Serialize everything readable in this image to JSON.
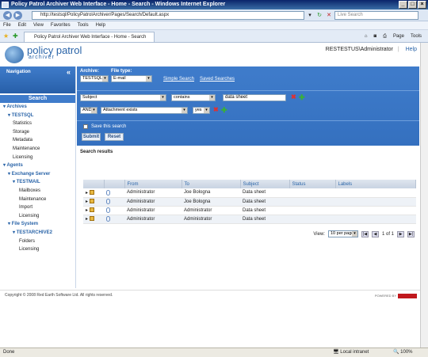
{
  "window": {
    "title": "Policy Patrol Archiver Web Interface - Home - Search - Windows Internet Explorer"
  },
  "browser": {
    "url": "http://testsql/PolicyPatrolArchiver/Pages/Search/Default.aspx",
    "search_placeholder": "Live Search",
    "menu": [
      "File",
      "Edit",
      "View",
      "Favorites",
      "Tools",
      "Help"
    ],
    "tab_title": "Policy Patrol Archiver Web Interface - Home - Search",
    "tools": {
      "page": "Page",
      "tools": "Tools"
    }
  },
  "app": {
    "brand": "policy patrol",
    "brand_sub": "archiver",
    "user": "RESTESTUS\\Administrator",
    "help": "Help"
  },
  "sidebar": {
    "header": "Navigation",
    "search": "Search",
    "items": [
      {
        "label": "Archives",
        "level": 0,
        "section": true
      },
      {
        "label": "TESTSQL",
        "level": 1,
        "section": true
      },
      {
        "label": "Statistics",
        "level": 2
      },
      {
        "label": "Storage",
        "level": 2
      },
      {
        "label": "Metadata",
        "level": 2
      },
      {
        "label": "Maintenance",
        "level": 2
      },
      {
        "label": "Licensing",
        "level": 2
      },
      {
        "label": "Agents",
        "level": 0,
        "section": true
      },
      {
        "label": "Exchange Server",
        "level": 1,
        "section": true
      },
      {
        "label": "TESTMAIL",
        "level": 2,
        "section": true
      },
      {
        "label": "Mailboxes",
        "level": 3
      },
      {
        "label": "Maintenance",
        "level": 3
      },
      {
        "label": "Import",
        "level": 3
      },
      {
        "label": "Licensing",
        "level": 3
      },
      {
        "label": "File System",
        "level": 1,
        "section": true
      },
      {
        "label": "TESTARCHIVE2",
        "level": 2,
        "section": true
      },
      {
        "label": "Folders",
        "level": 3
      },
      {
        "label": "Licensing",
        "level": 3
      }
    ]
  },
  "search_panel": {
    "archive_label": "Archive:",
    "archive_value": "TESTSQL",
    "filetype_label": "File type:",
    "filetype_value": "E-mail",
    "simple_search": "Simple Search",
    "saved_searches": "Saved Searches",
    "row1": {
      "field": "Subject",
      "operator": "contains",
      "value": "data sheet"
    },
    "row2": {
      "logic": "AND",
      "field": "Attachment exists",
      "value": "yes"
    },
    "save_label": "Save this search",
    "submit": "Submit",
    "reset": "Reset"
  },
  "results": {
    "title": "Search results",
    "columns": [
      "From",
      "To",
      "Subject",
      "Status",
      "Labels"
    ],
    "rows": [
      {
        "from": "Administrator",
        "to": "Joe Bologna",
        "subject": "Data sheet",
        "status": "",
        "labels": ""
      },
      {
        "from": "Administrator",
        "to": "Joe Bologna",
        "subject": "Data sheet",
        "status": "",
        "labels": ""
      },
      {
        "from": "Administrator",
        "to": "Administrator",
        "subject": "Data sheet",
        "status": "",
        "labels": ""
      },
      {
        "from": "Administrator",
        "to": "Administrator",
        "subject": "Data sheet",
        "status": "",
        "labels": ""
      }
    ],
    "view_label": "View:",
    "per_page": "10 per page",
    "page_info": "1 of 1"
  },
  "footer": {
    "copyright": "Copyright © 2008 Red Earth Software Ltd.  All rights reserved.",
    "powered": "POWERED BY"
  },
  "status": {
    "left": "Done",
    "zone": "Local intranet",
    "zoom": "100%"
  },
  "colors": {
    "accent": "#2a64a8",
    "panel": "#3f7ccb",
    "remove": "#e03030",
    "add": "#38b038"
  }
}
